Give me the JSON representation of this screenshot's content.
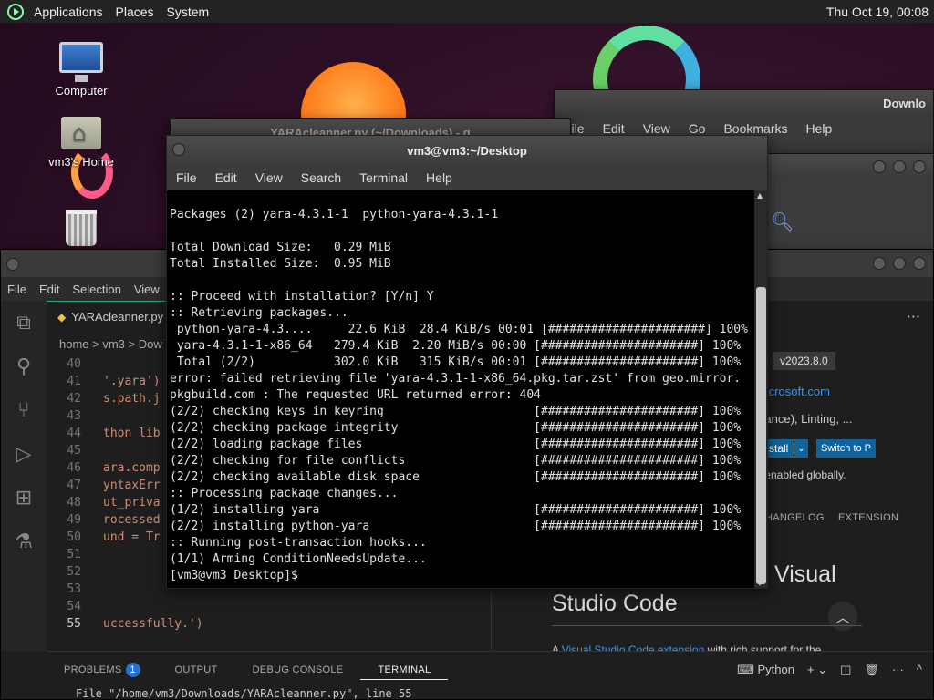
{
  "top_panel": {
    "menus": [
      "Applications",
      "Places",
      "System"
    ],
    "clock": "Thu Oct 19, 00:08"
  },
  "desktop_icons": {
    "computer": "Computer",
    "home": "vm3's Home"
  },
  "file_manager": {
    "title": "Downlo",
    "menus": [
      "File",
      "Edit",
      "View",
      "Go",
      "Bookmarks",
      "Help"
    ]
  },
  "editor_window": {
    "title": "YARAcleanner.py (~/Downloads) - g"
  },
  "terminal": {
    "title": "vm3@vm3:~/Desktop",
    "menus": [
      "File",
      "Edit",
      "View",
      "Search",
      "Terminal",
      "Help"
    ],
    "lines": [
      "",
      "Packages (2) yara-4.3.1-1  python-yara-4.3.1-1",
      "",
      "Total Download Size:   0.29 MiB",
      "Total Installed Size:  0.95 MiB",
      "",
      ":: Proceed with installation? [Y/n] Y",
      ":: Retrieving packages...",
      " python-yara-4.3....     22.6 KiB  28.4 KiB/s 00:01 [######################] 100%",
      " yara-4.3.1-1-x86_64   279.4 KiB  2.20 MiB/s 00:00 [######################] 100%",
      " Total (2/2)           302.0 KiB   315 KiB/s 00:01 [######################] 100%",
      "error: failed retrieving file 'yara-4.3.1-1-x86_64.pkg.tar.zst' from geo.mirror.",
      "pkgbuild.com : The requested URL returned error: 404",
      "(2/2) checking keys in keyring                     [######################] 100%",
      "(2/2) checking package integrity                   [######################] 100%",
      "(2/2) loading package files                        [######################] 100%",
      "(2/2) checking for file conflicts                  [######################] 100%",
      "(2/2) checking available disk space                [######################] 100%",
      ":: Processing package changes...",
      "(1/2) installing yara                              [######################] 100%",
      "(2/2) installing python-yara                       [######################] 100%",
      ":: Running post-transaction hooks...",
      "(1/1) Arming ConditionNeedsUpdate...",
      "[vm3@vm3 Desktop]$ "
    ]
  },
  "vscode": {
    "menus": [
      "File",
      "Edit",
      "Selection",
      "View"
    ],
    "tab": "YARAcleanner.py",
    "breadcrumb": "home > vm3 > Dow",
    "lines": [
      {
        "n": "40",
        "code": ""
      },
      {
        "n": "41",
        "code": "'.yara')"
      },
      {
        "n": "42",
        "code": "s.path.j"
      },
      {
        "n": "43",
        "code": ""
      },
      {
        "n": "44",
        "code": "thon lib"
      },
      {
        "n": "45",
        "code": ""
      },
      {
        "n": "46",
        "code": "ara.comp"
      },
      {
        "n": "47",
        "code": "yntaxErr"
      },
      {
        "n": "48",
        "code": "ut_priva"
      },
      {
        "n": "49",
        "code": "rocessed"
      },
      {
        "n": "50",
        "code": "und = Tr"
      },
      {
        "n": "51",
        "code": ""
      },
      {
        "n": "52",
        "code": ""
      },
      {
        "n": "53",
        "code": ""
      },
      {
        "n": "54",
        "code": ""
      },
      {
        "n": "55",
        "code": "uccessfully.')"
      }
    ],
    "extension": {
      "version": "v2023.8.0",
      "link": "microsoft.com",
      "desc": "ylance), Linting, ...",
      "install": "stall",
      "switch": "Switch to P",
      "enabled": "s enabled globally.",
      "tabs": [
        "HANGELOG",
        "EXTENSION"
      ],
      "heading1": "Visual",
      "heading2": "Studio Code",
      "body_a": "A ",
      "body_link": "Visual Studio Code extension",
      "body_b": " with rich support for the"
    },
    "panel": {
      "tabs": [
        "PROBLEMS",
        "OUTPUT",
        "DEBUG CONSOLE",
        "TERMINAL"
      ],
      "problems_count": "1",
      "shell": "Python",
      "terminal_line": "File \"/home/vm3/Downloads/YARAcleanner.py\", line 55"
    }
  }
}
